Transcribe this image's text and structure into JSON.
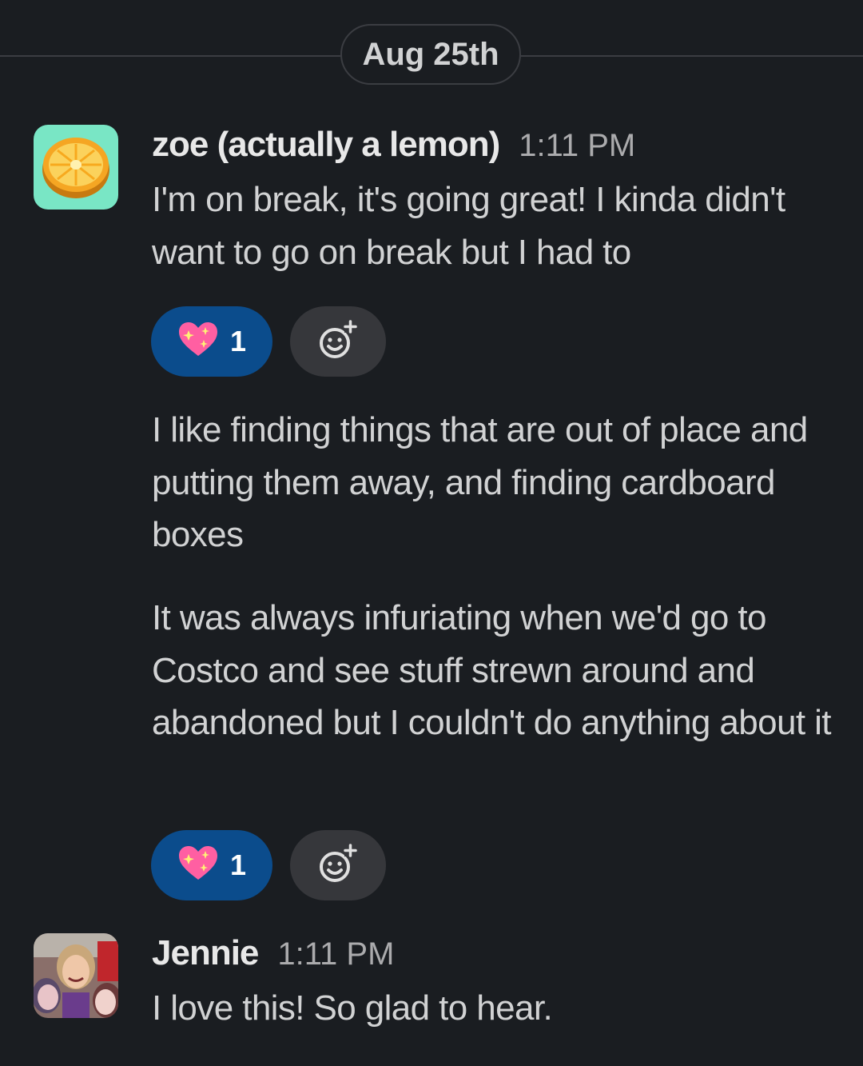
{
  "date_divider": {
    "label": "Aug 25th"
  },
  "messages": [
    {
      "sender": "zoe (actually a lemon)",
      "time": "1:11 PM",
      "avatar_icon": "lemon-slice-avatar",
      "paragraphs": [
        {
          "text": "I'm on break, it's going great! I kinda didn't want to go on break but I had to",
          "reaction": {
            "emoji": "sparkling-heart",
            "count": "1"
          }
        },
        {
          "text": "I like finding things that are out of place and putting them away, and finding cardboard boxes"
        },
        {
          "text": "It was always infuriating when we'd go to Costco and see stuff strewn around and abandoned but I couldn't do anything about it",
          "reaction": {
            "emoji": "sparkling-heart",
            "count": "1"
          }
        }
      ]
    },
    {
      "sender": "Jennie",
      "time": "1:11 PM",
      "avatar_icon": "profile-photo-avatar",
      "paragraphs": [
        {
          "text": "I love this! So glad to hear."
        }
      ]
    }
  ],
  "colors": {
    "background": "#1a1d21",
    "reaction_bg": "#0b4c8c",
    "add_reaction_bg": "#36373b",
    "text": "#d1d2d3",
    "timestamp": "#ababad"
  }
}
